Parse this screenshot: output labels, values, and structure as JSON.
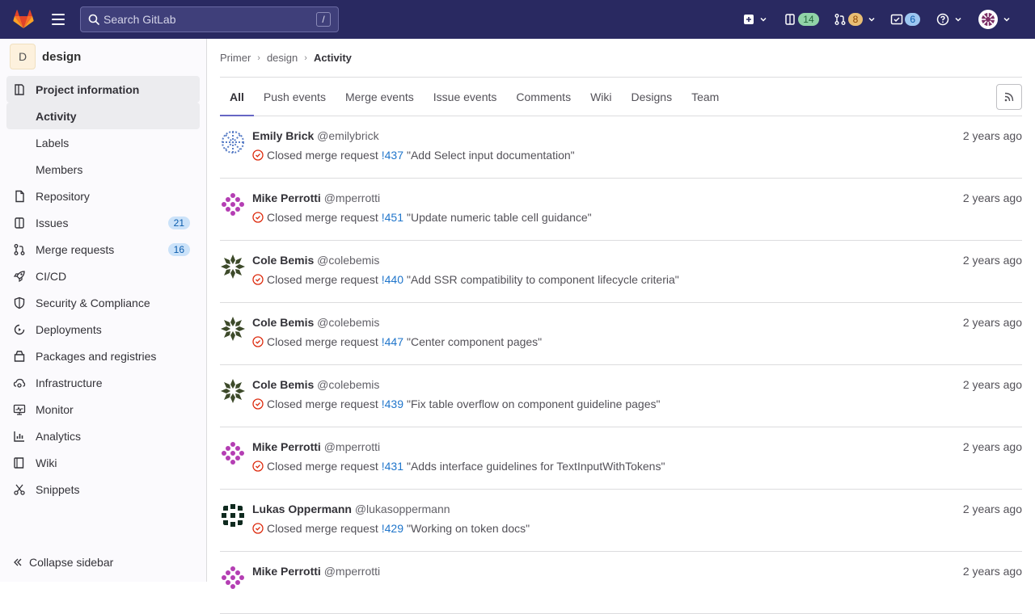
{
  "topbar": {
    "search_placeholder": "Search GitLab",
    "search_shortcut": "/",
    "issues_count": "14",
    "mr_count": "8",
    "todo_count": "6"
  },
  "sidebar": {
    "project_initial": "D",
    "project_name": "design",
    "items": [
      {
        "label": "Project information",
        "icon": "info-icon"
      },
      {
        "label": "Activity"
      },
      {
        "label": "Labels"
      },
      {
        "label": "Members"
      },
      {
        "label": "Repository",
        "icon": "doc-icon"
      },
      {
        "label": "Issues",
        "icon": "issues-icon",
        "count": "21"
      },
      {
        "label": "Merge requests",
        "icon": "merge-request-icon",
        "count": "16"
      },
      {
        "label": "CI/CD",
        "icon": "rocket-icon"
      },
      {
        "label": "Security & Compliance",
        "icon": "shield-icon"
      },
      {
        "label": "Deployments",
        "icon": "deployments-icon"
      },
      {
        "label": "Packages and registries",
        "icon": "package-icon"
      },
      {
        "label": "Infrastructure",
        "icon": "cloud-gear-icon"
      },
      {
        "label": "Monitor",
        "icon": "monitor-icon"
      },
      {
        "label": "Analytics",
        "icon": "chart-icon"
      },
      {
        "label": "Wiki",
        "icon": "book-icon"
      },
      {
        "label": "Snippets",
        "icon": "scissors-icon"
      }
    ],
    "collapse_label": "Collapse sidebar"
  },
  "breadcrumb": [
    "Primer",
    "design",
    "Activity"
  ],
  "tabs": [
    "All",
    "Push events",
    "Merge events",
    "Issue events",
    "Comments",
    "Wiki",
    "Designs",
    "Team"
  ],
  "events": [
    {
      "name": "Emily Brick",
      "user": "@emilybrick",
      "action": "Closed merge request",
      "ref": "!437",
      "title": "\"Add Select input documentation\"",
      "time": "2 years ago",
      "avatar": "blue"
    },
    {
      "name": "Mike Perrotti",
      "user": "@mperrotti",
      "action": "Closed merge request",
      "ref": "!451",
      "title": "\"Update numeric table cell guidance\"",
      "time": "2 years ago",
      "avatar": "purple"
    },
    {
      "name": "Cole Bemis",
      "user": "@colebemis",
      "action": "Closed merge request",
      "ref": "!440",
      "title": "\"Add SSR compatibility to component lifecycle criteria\"",
      "time": "2 years ago",
      "avatar": "olive"
    },
    {
      "name": "Cole Bemis",
      "user": "@colebemis",
      "action": "Closed merge request",
      "ref": "!447",
      "title": "\"Center component pages\"",
      "time": "2 years ago",
      "avatar": "olive"
    },
    {
      "name": "Cole Bemis",
      "user": "@colebemis",
      "action": "Closed merge request",
      "ref": "!439",
      "title": "\"Fix table overflow on component guideline pages\"",
      "time": "2 years ago",
      "avatar": "olive"
    },
    {
      "name": "Mike Perrotti",
      "user": "@mperrotti",
      "action": "Closed merge request",
      "ref": "!431",
      "title": "\"Adds interface guidelines for TextInputWithTokens\"",
      "time": "2 years ago",
      "avatar": "purple"
    },
    {
      "name": "Lukas Oppermann",
      "user": "@lukasoppermann",
      "action": "Closed merge request",
      "ref": "!429",
      "title": "\"Working on token docs\"",
      "time": "2 years ago",
      "avatar": "dark"
    },
    {
      "name": "Mike Perrotti",
      "user": "@mperrotti",
      "action": "",
      "ref": "",
      "title": "",
      "time": "2 years ago",
      "avatar": "purple"
    }
  ],
  "colors": {
    "navbar": "#292961",
    "link": "#1f75cb",
    "closed_status": "#dd2b0e"
  }
}
